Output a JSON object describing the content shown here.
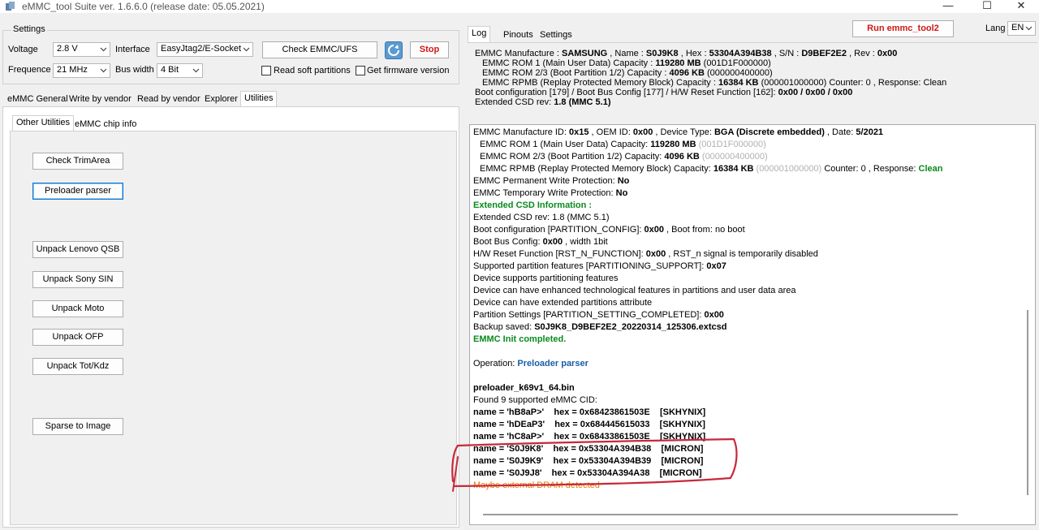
{
  "window": {
    "title": "eMMC_tool Suite  ver. 1.6.6.0 (release date: 05.05.2021)",
    "minimize": "—",
    "maximize": "☐",
    "close": "✕"
  },
  "settings": {
    "group_title": "Settings",
    "voltage_label": "Voltage",
    "voltage_value": "2.8 V",
    "interface_label": "Interface",
    "interface_value": "EasyJtag2/E-Socket",
    "frequence_label": "Frequence",
    "frequence_value": "21 MHz",
    "bus_width_label": "Bus width",
    "bus_width_value": "4 Bit",
    "check_button": "Check EMMC/UFS",
    "stop_button": "Stop",
    "read_soft_partitions": "Read soft partitions",
    "get_firmware_version": "Get firmware version"
  },
  "main_tabs": [
    "eMMC General",
    "Write by vendor",
    "Read by vendor",
    "Explorer",
    "Utilities"
  ],
  "sub_tabs": [
    "Other Utilities",
    "eMMC chip info"
  ],
  "utility_buttons": {
    "check_trimarea": "Check TrimArea",
    "preloader_parser": "Preloader parser",
    "unpack_lenovo": "Unpack Lenovo QSB",
    "unpack_sony": "Unpack Sony SIN",
    "unpack_moto": "Unpack Moto",
    "unpack_ofp": "Unpack OFP",
    "unpack_tot": "Unpack Tot/Kdz",
    "sparse_to_image": "Sparse to Image"
  },
  "right_tabs": [
    "Log",
    "Pinouts",
    "Settings"
  ],
  "run_button": "Run emmc_tool2",
  "lang_label": "Lang",
  "lang_value": "EN",
  "header_info": {
    "l1_a": "EMMC Manufacture :  ",
    "l1_b": "SAMSUNG",
    "l1_c": " , Name :  ",
    "l1_d": "S0J9K8",
    "l1_e": " , Hex :  ",
    "l1_f": "53304A394B38",
    "l1_g": " , S/N :  ",
    "l1_h": "D9BEF2E2",
    "l1_i": " , Rev :  ",
    "l1_j": "0x00",
    "l2_a": "EMMC ROM 1 (Main User Data) Capacity :  ",
    "l2_b": "119280 MB",
    "l2_c": " (001D1F000000)",
    "l3_a": "EMMC ROM 2/3 (Boot Partition 1/2) Capacity :  ",
    "l3_b": "4096 KB",
    "l3_c": " (000000400000)",
    "l4_a": "EMMC RPMB (Replay Protected Memory Block) Capacity :  ",
    "l4_b": "16384 KB",
    "l4_c": " (000001000000) Counter: 0 , Response: Clean",
    "l5_a": "Boot configuration [179] / Boot Bus Config [177] / H/W Reset Function [162]:  ",
    "l5_b": "0x00 / 0x00 / 0x00",
    "l6_a": "Extended CSD rev:  ",
    "l6_b": "1.8 (MMC 5.1)"
  },
  "log": {
    "l1_a": "EMMC Manufacture ID: ",
    "l1_b": "0x15",
    "l1_c": " , OEM ID: ",
    "l1_d": "0x00",
    "l1_e": " , Device Type: ",
    "l1_f": "BGA (Discrete embedded)",
    "l1_g": " , Date: ",
    "l1_h": "5/2021",
    "l2_a": "EMMC ROM 1 (Main User Data) Capacity: ",
    "l2_b": "119280 MB",
    "l2_c": " (001D1F000000)",
    "l3_a": "EMMC ROM 2/3 (Boot Partition 1/2) Capacity: ",
    "l3_b": "4096 KB",
    "l3_c": " (000000400000)",
    "l4_a": "EMMC RPMB (Replay Protected Memory Block) Capacity: ",
    "l4_b": "16384 KB",
    "l4_c": " (000001000000)",
    "l4_d": "  Counter: 0 , Response: ",
    "l4_e": "Clean",
    "l5_a": "EMMC Permanent Write Protection: ",
    "l5_b": "No",
    "l6_a": "EMMC Temporary Write Protection: ",
    "l6_b": "No",
    "l7": "Extended CSD Information :",
    "l8": "Extended CSD rev: 1.8 (MMC 5.1)",
    "l9_a": "Boot configuration [PARTITION_CONFIG]: ",
    "l9_b": "0x00",
    "l9_c": " , Boot from: no boot",
    "l10_a": "Boot Bus Config: ",
    "l10_b": "0x00",
    "l10_c": " , width 1bit",
    "l11_a": "H/W Reset Function [RST_N_FUNCTION]: ",
    "l11_b": "0x00",
    "l11_c": " , RST_n signal is temporarily disabled",
    "l12_a": "Supported partition features [PARTITIONING_SUPPORT]: ",
    "l12_b": "0x07",
    "l13": "Device supports partitioning features",
    "l14": "Device can have enhanced technological features in partitions and user data area",
    "l15": "Device can have extended partitions attribute",
    "l16_a": "Partition Settings [PARTITION_SETTING_COMPLETED]: ",
    "l16_b": "0x00",
    "l17_a": "Backup saved: ",
    "l17_b": "S0J9K8_D9BEF2E2_20220314_125306.extcsd",
    "l18": "EMMC Init completed.",
    "l19_a": "Operation: ",
    "l19_b": "Preloader parser",
    "l20": "preloader_k69v1_64.bin",
    "l21": "Found 9 supported eMMC CID:",
    "cids": [
      "name = 'hB8aP>'    hex = 0x68423861503E    [SKHYNIX]",
      "name = 'hDEaP3'    hex = 0x684445615033    [SKHYNIX]",
      "name = 'hC8aP>'    hex = 0x68433861503E    [SKHYNIX]",
      "name = 'S0J9K8'    hex = 0x53304A394B38    [MICRON]",
      "name = 'S0J9K9'    hex = 0x53304A394B39    [MICRON]",
      "name = 'S0J9J8'    hex = 0x53304A394A38    [MICRON]"
    ],
    "l28": "Maybe external DRAM detected"
  },
  "colors": {
    "annotation": "#c8283a",
    "green": "#0a8a1e",
    "blue": "#1a5ea8",
    "orange": "#e87a00",
    "stop": "#d01818"
  }
}
